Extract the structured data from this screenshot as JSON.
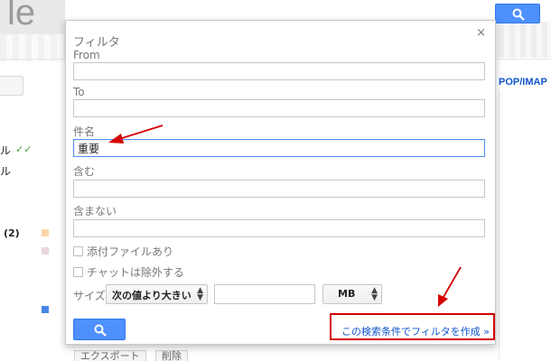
{
  "background": {
    "logo_text": "le",
    "pop_imap_label": "POP/IMAP",
    "left_text_1": "ル",
    "left_text_2": "ル",
    "left_count": "(2)",
    "bottom_buttons": [
      "エクスポート",
      "削除"
    ]
  },
  "filter_dialog": {
    "title": "フィルタ",
    "close_label": "×",
    "from": {
      "label": "From",
      "value": ""
    },
    "to": {
      "label": "To",
      "value": ""
    },
    "subject": {
      "label": "件名",
      "value": "重要"
    },
    "has_words": {
      "label": "含む",
      "value": ""
    },
    "doesnt_have": {
      "label": "含まない",
      "value": ""
    },
    "has_attachment": {
      "label": "添付ファイルあり",
      "checked": false
    },
    "exclude_chats": {
      "label": "チャットは除外する",
      "checked": false
    },
    "size": {
      "label": "サイズ",
      "operator": "次の値より大きい",
      "value": "",
      "unit": "MB"
    },
    "search_button_icon": "search-icon",
    "create_filter_link": "この検索条件でフィルタを作成 »"
  },
  "colors": {
    "accent_blue": "#4d90fe",
    "link_blue": "#1155cc",
    "annotation_red": "#d40000"
  }
}
